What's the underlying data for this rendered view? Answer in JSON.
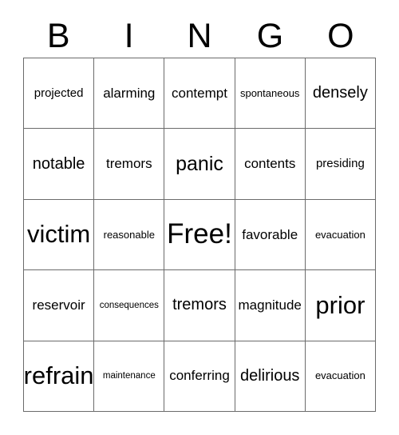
{
  "card": {
    "title_letters": [
      "B",
      "I",
      "N",
      "G",
      "O"
    ],
    "border_color": "#6b6b6b",
    "text_color": "#000000",
    "background_color": "#ffffff",
    "rows": [
      [
        {
          "text": "projected",
          "size": "s"
        },
        {
          "text": "alarming",
          "size": "m"
        },
        {
          "text": "contempt",
          "size": "m"
        },
        {
          "text": "spontaneous",
          "size": "xs"
        },
        {
          "text": "densely",
          "size": "l"
        }
      ],
      [
        {
          "text": "notable",
          "size": "l"
        },
        {
          "text": "tremors",
          "size": "m"
        },
        {
          "text": "panic",
          "size": "xl"
        },
        {
          "text": "contents",
          "size": "m"
        },
        {
          "text": "presiding",
          "size": "s"
        }
      ],
      [
        {
          "text": "victim",
          "size": "xxl"
        },
        {
          "text": "reasonable",
          "size": "xs"
        },
        {
          "text": "Free!",
          "size": "free"
        },
        {
          "text": "favorable",
          "size": "m"
        },
        {
          "text": "evacuation",
          "size": "xs"
        }
      ],
      [
        {
          "text": "reservoir",
          "size": "m"
        },
        {
          "text": "consequences",
          "size": "xxs"
        },
        {
          "text": "tremors",
          "size": "l"
        },
        {
          "text": "magnitude",
          "size": "m"
        },
        {
          "text": "prior",
          "size": "xxl"
        }
      ],
      [
        {
          "text": "refrain",
          "size": "xxl"
        },
        {
          "text": "maintenance",
          "size": "xxs"
        },
        {
          "text": "conferring",
          "size": "m"
        },
        {
          "text": "delirious",
          "size": "l"
        },
        {
          "text": "evacuation",
          "size": "xs"
        }
      ]
    ]
  }
}
